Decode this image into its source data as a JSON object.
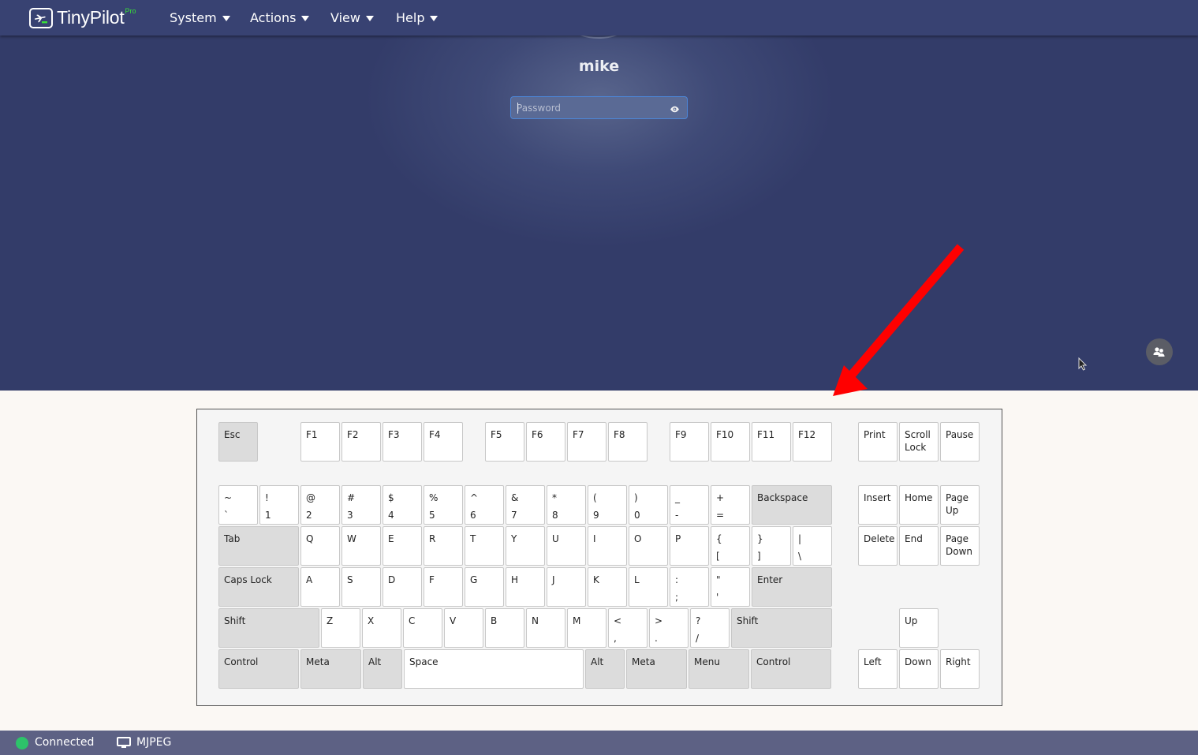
{
  "navbar": {
    "brand": "TinyPilot",
    "brand_badge": "Pro",
    "menus": [
      {
        "label": "System"
      },
      {
        "label": "Actions"
      },
      {
        "label": "View"
      },
      {
        "label": "Help"
      }
    ]
  },
  "remote_screen": {
    "username": "mike",
    "password_placeholder": "Password",
    "password_value": "",
    "reveal_icon": "eye-icon",
    "fab_icon": "users-icon",
    "annotation": {
      "type": "arrow",
      "color": "#ff0000",
      "direction": "down-left"
    }
  },
  "keyboard": {
    "rows": [
      [
        {
          "id": "esc",
          "label": "Esc",
          "mod": true
        },
        {
          "id": "f1",
          "label": "F1"
        },
        {
          "id": "f2",
          "label": "F2"
        },
        {
          "id": "f3",
          "label": "F3"
        },
        {
          "id": "f4",
          "label": "F4"
        },
        {
          "id": "f5",
          "label": "F5"
        },
        {
          "id": "f6",
          "label": "F6"
        },
        {
          "id": "f7",
          "label": "F7"
        },
        {
          "id": "f8",
          "label": "F8"
        },
        {
          "id": "f9",
          "label": "F9"
        },
        {
          "id": "f10",
          "label": "F10"
        },
        {
          "id": "f11",
          "label": "F11"
        },
        {
          "id": "f12",
          "label": "F12"
        },
        {
          "id": "print",
          "label": "Print"
        },
        {
          "id": "scroll-lock",
          "label": "Scroll\nLock"
        },
        {
          "id": "pause",
          "label": "Pause"
        }
      ],
      [
        {
          "id": "backquote",
          "top": "~",
          "bot": "`"
        },
        {
          "id": "1",
          "top": "!",
          "bot": "1"
        },
        {
          "id": "2",
          "top": "@",
          "bot": "2"
        },
        {
          "id": "3",
          "top": "#",
          "bot": "3"
        },
        {
          "id": "4",
          "top": "$",
          "bot": "4"
        },
        {
          "id": "5",
          "top": "%",
          "bot": "5"
        },
        {
          "id": "6",
          "top": "^",
          "bot": "6"
        },
        {
          "id": "7",
          "top": "&",
          "bot": "7"
        },
        {
          "id": "8",
          "top": "*",
          "bot": "8"
        },
        {
          "id": "9",
          "top": "(",
          "bot": "9"
        },
        {
          "id": "0",
          "top": ")",
          "bot": "0"
        },
        {
          "id": "minus",
          "top": "_",
          "bot": "-"
        },
        {
          "id": "equal",
          "top": "+",
          "bot": "="
        },
        {
          "id": "backspace",
          "label": "Backspace",
          "mod": true
        },
        {
          "id": "insert",
          "label": "Insert"
        },
        {
          "id": "home",
          "label": "Home"
        },
        {
          "id": "page-up",
          "label": "Page\nUp"
        }
      ],
      [
        {
          "id": "tab",
          "label": "Tab",
          "mod": true
        },
        {
          "id": "q",
          "label": "Q"
        },
        {
          "id": "w",
          "label": "W"
        },
        {
          "id": "e",
          "label": "E"
        },
        {
          "id": "r",
          "label": "R"
        },
        {
          "id": "t",
          "label": "T"
        },
        {
          "id": "y",
          "label": "Y"
        },
        {
          "id": "u",
          "label": "U"
        },
        {
          "id": "i",
          "label": "I"
        },
        {
          "id": "o",
          "label": "O"
        },
        {
          "id": "p",
          "label": "P"
        },
        {
          "id": "bracket-left",
          "top": "{",
          "bot": "["
        },
        {
          "id": "bracket-right",
          "top": "}",
          "bot": "]"
        },
        {
          "id": "backslash",
          "top": "|",
          "bot": "\\"
        },
        {
          "id": "delete",
          "label": "Delete"
        },
        {
          "id": "end",
          "label": "End"
        },
        {
          "id": "page-down",
          "label": "Page\nDown"
        }
      ],
      [
        {
          "id": "caps-lock",
          "label": "Caps Lock",
          "mod": true
        },
        {
          "id": "a",
          "label": "A"
        },
        {
          "id": "s",
          "label": "S"
        },
        {
          "id": "d",
          "label": "D"
        },
        {
          "id": "f",
          "label": "F"
        },
        {
          "id": "g",
          "label": "G"
        },
        {
          "id": "h",
          "label": "H"
        },
        {
          "id": "j",
          "label": "J"
        },
        {
          "id": "k",
          "label": "K"
        },
        {
          "id": "l",
          "label": "L"
        },
        {
          "id": "semicolon",
          "top": ":",
          "bot": ";"
        },
        {
          "id": "quote",
          "top": "\"",
          "bot": "'"
        },
        {
          "id": "enter",
          "label": "Enter",
          "mod": true
        }
      ],
      [
        {
          "id": "shift-left",
          "label": "Shift",
          "mod": true
        },
        {
          "id": "z",
          "label": "Z"
        },
        {
          "id": "x",
          "label": "X"
        },
        {
          "id": "c",
          "label": "C"
        },
        {
          "id": "v",
          "label": "V"
        },
        {
          "id": "b",
          "label": "B"
        },
        {
          "id": "n",
          "label": "N"
        },
        {
          "id": "m",
          "label": "M"
        },
        {
          "id": "comma",
          "top": "<",
          "bot": ","
        },
        {
          "id": "period",
          "top": ">",
          "bot": "."
        },
        {
          "id": "slash",
          "top": "?",
          "bot": "/"
        },
        {
          "id": "shift-right",
          "label": "Shift",
          "mod": true
        },
        {
          "id": "arrow-up",
          "label": "Up"
        }
      ],
      [
        {
          "id": "control-left",
          "label": "Control",
          "mod": true
        },
        {
          "id": "meta-left",
          "label": "Meta",
          "mod": true
        },
        {
          "id": "alt-left",
          "label": "Alt",
          "mod": true
        },
        {
          "id": "space",
          "label": "Space"
        },
        {
          "id": "alt-right",
          "label": "Alt",
          "mod": true
        },
        {
          "id": "meta-right",
          "label": "Meta",
          "mod": true
        },
        {
          "id": "menu",
          "label": "Menu",
          "mod": true
        },
        {
          "id": "control-right",
          "label": "Control",
          "mod": true
        },
        {
          "id": "arrow-left",
          "label": "Left"
        },
        {
          "id": "arrow-down",
          "label": "Down"
        },
        {
          "id": "arrow-right",
          "label": "Right"
        }
      ]
    ]
  },
  "statusbar": {
    "connection_status": "Connected",
    "connection_color": "#2dc36a",
    "stream_icon": "monitor-icon",
    "stream_mode": "MJPEG"
  },
  "colors": {
    "navbar": "#384272",
    "screen_bg": "#333c69",
    "statusbar": "#5d6184",
    "accent_input_border": "#4c86d8",
    "modifier_key": "#dcdcdc"
  }
}
